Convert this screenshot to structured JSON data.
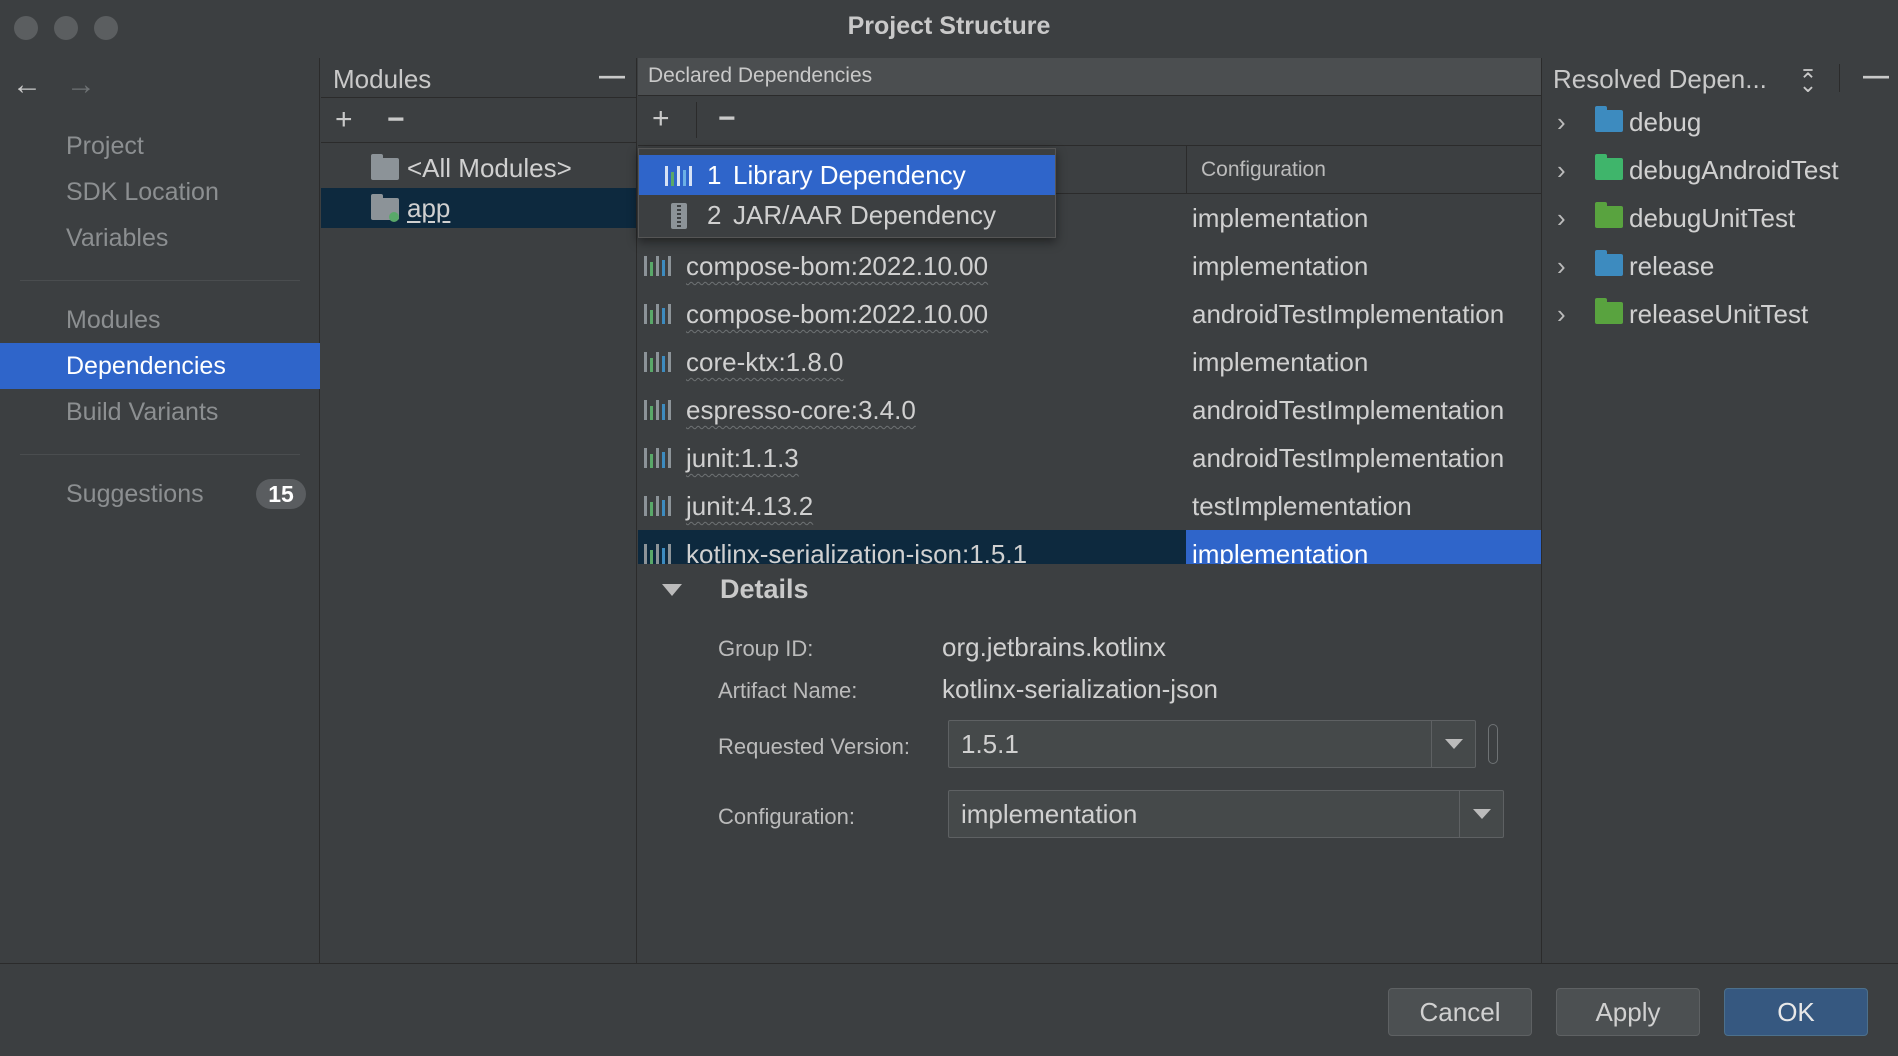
{
  "window": {
    "title": "Project Structure"
  },
  "nav": {
    "back": "←",
    "forward": "→",
    "items": [
      {
        "label": "Project"
      },
      {
        "label": "SDK Location"
      },
      {
        "label": "Variables"
      },
      {
        "label": "Modules"
      },
      {
        "label": "Dependencies"
      },
      {
        "label": "Build Variants"
      },
      {
        "label": "Suggestions"
      }
    ],
    "selected": "Dependencies",
    "suggestions_count": "15"
  },
  "modules": {
    "title": "Modules",
    "items": [
      {
        "label": "<All Modules>"
      },
      {
        "label": "app"
      }
    ],
    "selected": "app"
  },
  "declared": {
    "title": "Declared Dependencies",
    "column_configuration": "Configuration",
    "rows": [
      {
        "name": "",
        "configuration": "implementation"
      },
      {
        "name": "compose-bom:2022.10.00",
        "configuration": "implementation"
      },
      {
        "name": "compose-bom:2022.10.00",
        "configuration": "androidTestImplementation"
      },
      {
        "name": "core-ktx:1.8.0",
        "configuration": "implementation"
      },
      {
        "name": "espresso-core:3.4.0",
        "configuration": "androidTestImplementation"
      },
      {
        "name": "junit:1.1.3",
        "configuration": "androidTestImplementation"
      },
      {
        "name": "junit:4.13.2",
        "configuration": "testImplementation"
      },
      {
        "name": "kotlinx-serialization-json:1.5.1",
        "configuration": "implementation"
      }
    ],
    "selected_row": "kotlinx-serialization-json:1.5.1"
  },
  "add_menu": {
    "items": [
      {
        "num": "1",
        "label": "Library Dependency"
      },
      {
        "num": "2",
        "label": "JAR/AAR Dependency"
      }
    ]
  },
  "details": {
    "title": "Details",
    "group_id_label": "Group ID:",
    "group_id": "org.jetbrains.kotlinx",
    "artifact_label": "Artifact Name:",
    "artifact": "kotlinx-serialization-json",
    "version_label": "Requested Version:",
    "version": "1.5.1",
    "config_label": "Configuration:",
    "config": "implementation"
  },
  "resolved": {
    "title": "Resolved Depen...",
    "items": [
      {
        "label": "debug",
        "color": "#3d8bbf"
      },
      {
        "label": "debugAndroidTest",
        "color": "#3fb56b"
      },
      {
        "label": "debugUnitTest",
        "color": "#59a33f"
      },
      {
        "label": "release",
        "color": "#3d8bbf"
      },
      {
        "label": "releaseUnitTest",
        "color": "#59a33f"
      }
    ]
  },
  "buttons": {
    "cancel": "Cancel",
    "apply": "Apply",
    "ok": "OK"
  },
  "colors": {
    "selection": "#2f65ca",
    "inactive_selection": "#0d293e",
    "background": "#3c3f41"
  },
  "icons": [
    "back-arrow-icon",
    "forward-arrow-icon",
    "plus-icon",
    "minus-icon",
    "folder-icon",
    "library-icon",
    "jar-icon",
    "chevron-right-icon",
    "collapse-all-icon",
    "dropdown-arrow-icon"
  ]
}
